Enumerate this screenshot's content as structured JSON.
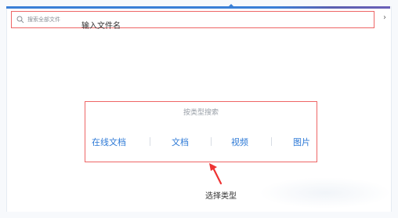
{
  "search": {
    "placeholder": "搜索全部文件",
    "annotation": "输入文件名",
    "close_glyph": "›"
  },
  "type_search": {
    "title": "按类型搜索",
    "types": [
      "在线文档",
      "文档",
      "视频",
      "图片"
    ],
    "annotation": "选择类型"
  },
  "colors": {
    "accent_blue": "#2d79d6",
    "annotation_red": "#e66666",
    "top_bar": "#3a7fd6"
  },
  "icons": {
    "search": "search-icon",
    "close": "close-icon",
    "arrow": "arrow-annotation"
  }
}
